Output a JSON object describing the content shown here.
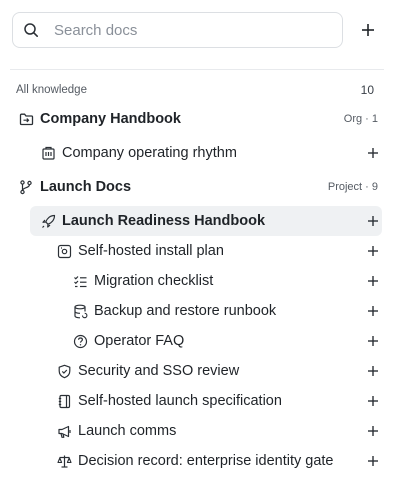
{
  "search": {
    "placeholder": "Search docs",
    "icon": "search-icon"
  },
  "toolbar": {
    "add_icon": "plus-icon"
  },
  "section": {
    "title": "All knowledge",
    "count": "10"
  },
  "tree": [
    {
      "label": "Company Handbook",
      "icon": "folder-icon",
      "meta": "Org · 1"
    },
    {
      "label": "Company operating rhythm",
      "icon": "building-icon"
    },
    {
      "label": "Launch Docs",
      "icon": "branch-icon",
      "meta": "Project · 9"
    },
    {
      "label": "Launch Readiness Handbook",
      "icon": "rocket-icon",
      "selected": true
    },
    {
      "label": "Self-hosted install plan",
      "icon": "server-icon"
    },
    {
      "label": "Migration checklist",
      "icon": "checklist-icon"
    },
    {
      "label": "Backup and restore runbook",
      "icon": "database-icon"
    },
    {
      "label": "Operator FAQ",
      "icon": "help-circle-icon"
    },
    {
      "label": "Security and SSO review",
      "icon": "shield-icon"
    },
    {
      "label": "Self-hosted launch specification",
      "icon": "notebook-icon"
    },
    {
      "label": "Launch comms",
      "icon": "megaphone-icon"
    },
    {
      "label": "Decision record: enterprise identity gate",
      "icon": "scale-icon"
    }
  ]
}
